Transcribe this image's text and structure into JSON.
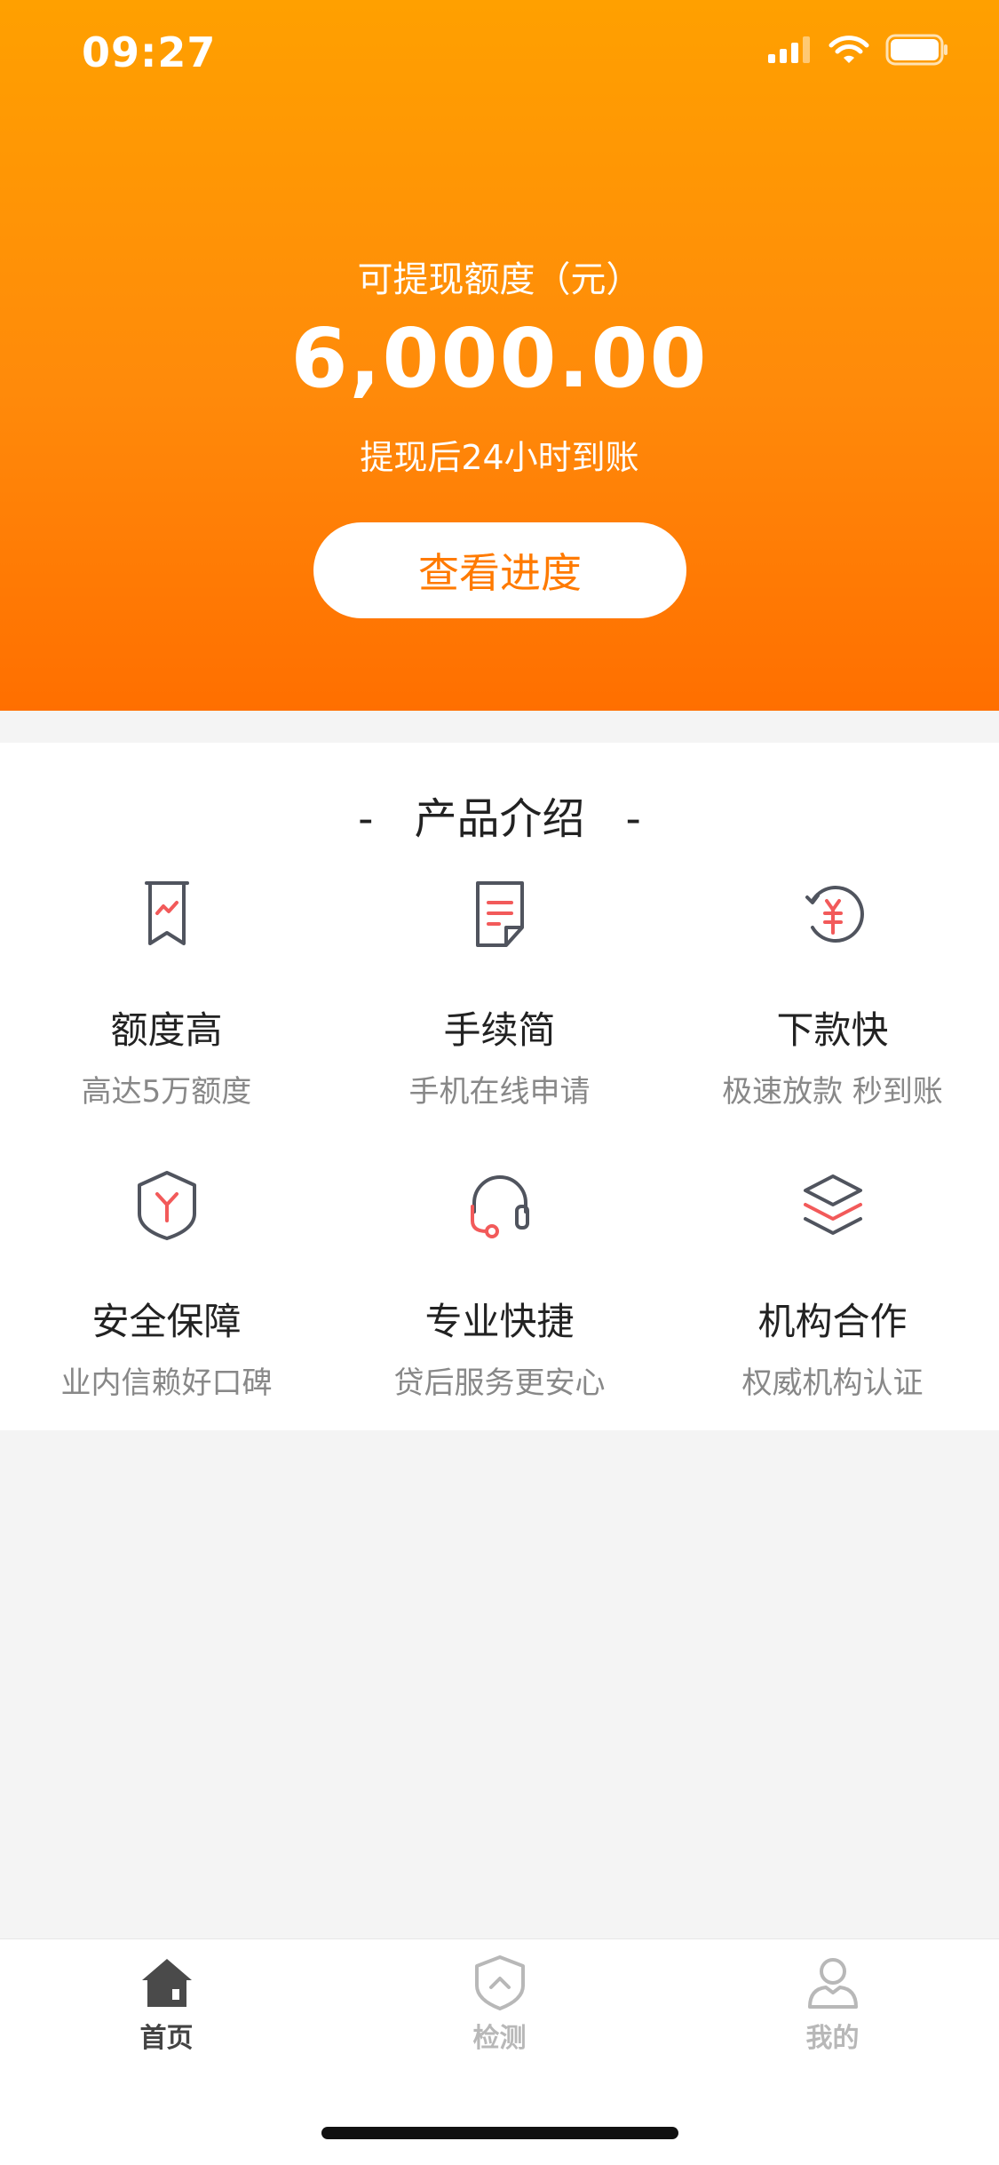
{
  "status_bar": {
    "time": "09:27"
  },
  "hero": {
    "label": "可提现额度（元）",
    "amount": "6,000.00",
    "note": "提现后24小时到账",
    "button_label": "查看进度"
  },
  "intro": {
    "title": "产品介绍",
    "dash": "-",
    "features": [
      {
        "icon": "chart-flag-icon",
        "title": "额度高",
        "subtitle": "高达5万额度"
      },
      {
        "icon": "document-icon",
        "title": "手续简",
        "subtitle": "手机在线申请"
      },
      {
        "icon": "yen-refresh-icon",
        "title": "下款快",
        "subtitle": "极速放款 秒到账"
      },
      {
        "icon": "shield-icon",
        "title": "安全保障",
        "subtitle": "业内信赖好口碑"
      },
      {
        "icon": "headset-icon",
        "title": "专业快捷",
        "subtitle": "贷后服务更安心"
      },
      {
        "icon": "layers-icon",
        "title": "机构合作",
        "subtitle": "权威机构认证"
      }
    ]
  },
  "tabbar": {
    "tabs": [
      {
        "label": "首页",
        "icon": "home-icon",
        "active": true
      },
      {
        "label": "检测",
        "icon": "shield-check-icon",
        "active": false
      },
      {
        "label": "我的",
        "icon": "user-icon",
        "active": false
      }
    ]
  },
  "colors": {
    "accent": "#ff7a00",
    "icon_red": "#f25a5a",
    "icon_gray": "#50545e",
    "tab_active": "#444444",
    "tab_inactive": "#b8b8b8"
  }
}
